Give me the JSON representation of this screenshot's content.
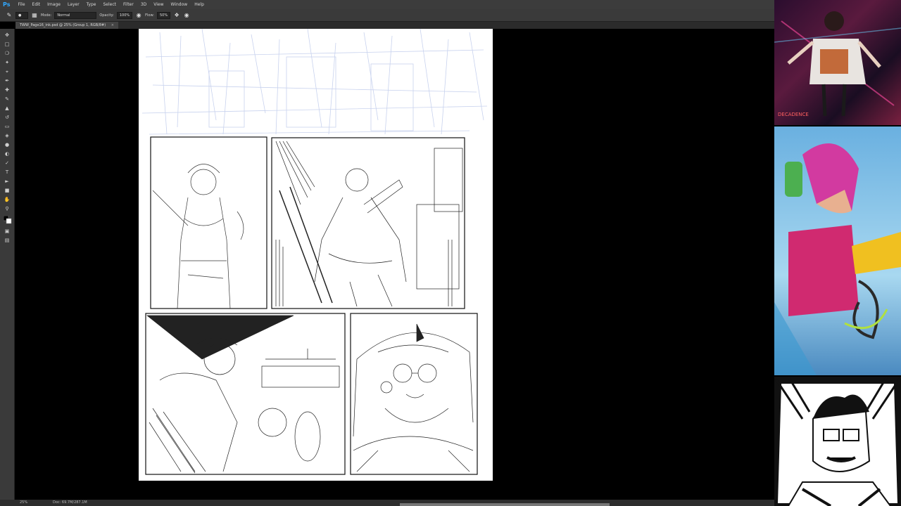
{
  "app": {
    "logo": "Ps"
  },
  "menu": [
    "File",
    "Edit",
    "Image",
    "Layer",
    "Type",
    "Select",
    "Filter",
    "3D",
    "View",
    "Window",
    "Help"
  ],
  "options": {
    "mode_label": "Mode:",
    "mode_value": "Normal",
    "opacity_label": "Opacity:",
    "opacity_value": "100%",
    "flow_label": "Flow:",
    "flow_value": "50%"
  },
  "document_tab": {
    "title": "TWW_Page16_ink.psd @ 25% (Group 1, RGB/8#)",
    "close": "×"
  },
  "status": {
    "zoom": "25%",
    "doc_info": "Doc: 69.7M/287.1M"
  },
  "side_panels": {
    "top_caption": "DECADENCE"
  }
}
